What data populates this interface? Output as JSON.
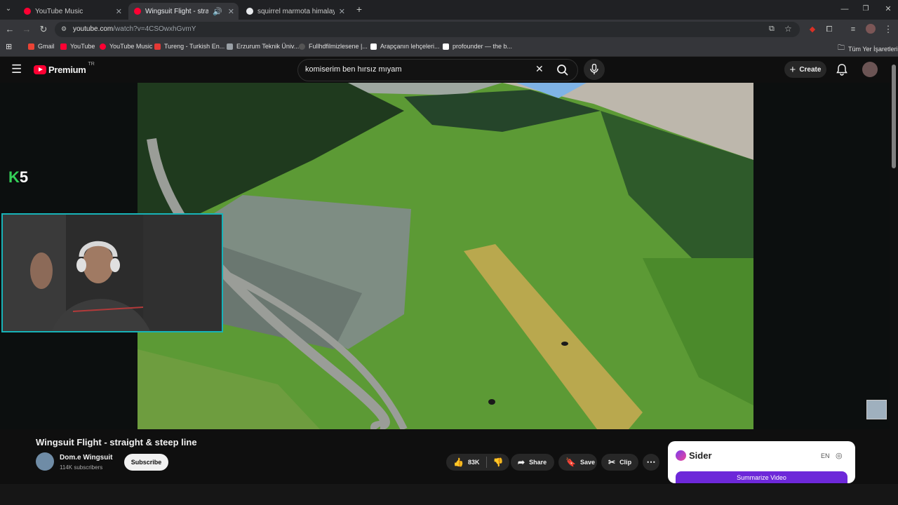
{
  "browser": {
    "tabs": [
      {
        "title": "YouTube Music",
        "favicon_color": "#ff0033"
      },
      {
        "title": "Wingsuit Flight - straight &",
        "favicon_color": "#ff0033"
      },
      {
        "title": "squirrel marmota himalaya - G",
        "favicon_color": "#e8eaed"
      }
    ],
    "new_tab": "+",
    "url_host": "youtube.com",
    "url_path": "/watch?v=4CSOwxhGvmY",
    "bookmarks": [
      {
        "label": "Gmail",
        "color": "#ea4335"
      },
      {
        "label": "YouTube",
        "color": "#ff0033"
      },
      {
        "label": "YouTube Music",
        "color": "#ff0033"
      },
      {
        "label": "Tureng - Turkish En...",
        "color": "#e53935"
      },
      {
        "label": "Erzurum Teknik Üniv...",
        "color": "#9aa0a6"
      },
      {
        "label": "Fullhdfilmizlesene |...",
        "color": "#444444"
      },
      {
        "label": "Arapçanın lehçeleri...",
        "color": "#ffffff"
      },
      {
        "label": "profounder — the b...",
        "color": "#ffffff"
      }
    ],
    "all_bookmarks": "Tüm Yer İşaretleri"
  },
  "youtube": {
    "logo": "Premium",
    "region": "TR",
    "search_query": "komiserim ben hırsız mıyam",
    "create_label": "Create",
    "overlay_logo_letter": "K",
    "overlay_logo_number": "5",
    "video_title": "Wingsuit Flight - straight & steep line",
    "channel_name": "Dom.e Wingsuit",
    "subscribers": "114K subscribers",
    "subscribe_label": "Subscribe",
    "likes": "83K",
    "share_label": "Share",
    "save_label": "Save",
    "clip_label": "Clip",
    "more_label": "⋯"
  },
  "sider": {
    "name": "Sider",
    "lang": "EN",
    "summarize_label": "Summarize Video"
  }
}
